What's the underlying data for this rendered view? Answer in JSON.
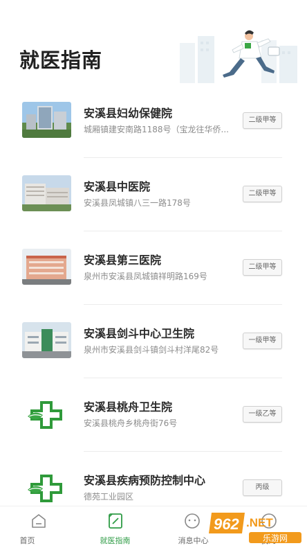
{
  "header": {
    "title": "就医指南"
  },
  "hospitals": [
    {
      "name": "安溪县妇幼保健院",
      "address": "城厢镇建安南路1188号（宝龙往华侨...",
      "level": "二级甲等",
      "thumb": "photo"
    },
    {
      "name": "安溪县中医院",
      "address": "安溪县凤城镇八三一路178号",
      "level": "二级甲等",
      "thumb": "photo"
    },
    {
      "name": "安溪县第三医院",
      "address": "泉州市安溪县凤城镇祥明路169号",
      "level": "二级甲等",
      "thumb": "photo"
    },
    {
      "name": "安溪县剑斗中心卫生院",
      "address": "泉州市安溪县剑斗镇剑斗村洋尾82号",
      "level": "一级甲等",
      "thumb": "photo"
    },
    {
      "name": "安溪县桃舟卫生院",
      "address": "安溪县桃舟乡桃舟街76号",
      "level": "一级乙等",
      "thumb": "cross-logo"
    },
    {
      "name": "安溪县疾病预防控制中心",
      "address": "德苑工业园区",
      "level": "丙级",
      "thumb": "cross-logo"
    }
  ],
  "tabs": [
    {
      "label": "首页",
      "icon": "home-icon",
      "active": false
    },
    {
      "label": "就医指南",
      "icon": "guide-icon",
      "active": true
    },
    {
      "label": "消息中心",
      "icon": "message-icon",
      "active": false
    },
    {
      "label": "我的",
      "icon": "profile-icon",
      "active": false
    }
  ],
  "watermark": {
    "brand": "962",
    "suffix": ".NET",
    "sub": "乐游网"
  },
  "colors": {
    "accent": "#2e9b45",
    "cross_green": "#2f9a3a",
    "leaf_green": "#3aa645"
  }
}
